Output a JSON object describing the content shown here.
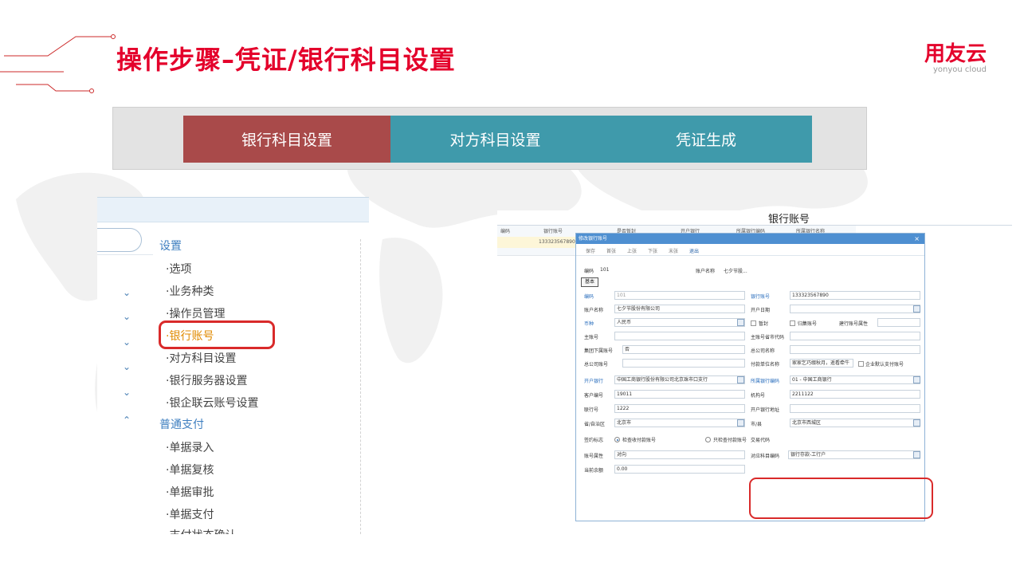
{
  "slide": {
    "title": "操作步骤–凭证/银行科目设置"
  },
  "brand": {
    "logo_cn": "用友云",
    "logo_en": "yonyou cloud"
  },
  "tabs": [
    {
      "label": "银行科目设置"
    },
    {
      "label": "对方科目设置"
    },
    {
      "label": "凭证生成"
    }
  ],
  "menu": {
    "section1": "设置",
    "items1": [
      "·选项",
      "·业务种类",
      "·操作员管理",
      "·银行账号",
      "·对方科目设置",
      "·银行服务器设置",
      "·银企联云账号设置"
    ],
    "section2": "普通支付",
    "items2": [
      "·单据录入",
      "·单据复核",
      "·单据审批",
      "·单据支付",
      "·支付状态确认"
    ]
  },
  "bank_list": {
    "title": "银行账号",
    "columns": [
      "编码",
      "银行账号",
      "是否暂封",
      "开户银行",
      "所属银行编码",
      "所属银行名称"
    ],
    "row1_account": "133323567890"
  },
  "dialog": {
    "title": "修改银行账号",
    "close": "×",
    "toolbar": [
      "保存",
      "首张",
      "上张",
      "下张",
      "末张",
      "退出"
    ],
    "summary_code_label": "编码",
    "summary_code": "101",
    "summary_name_label": "账户名称",
    "summary_name": "七夕节股...",
    "tab": "基本",
    "fields": {
      "code_label": "编码",
      "code": "101",
      "bank_account_label": "银行账号",
      "bank_account": "133323567890",
      "account_name_label": "账户名称",
      "account_name": "七夕节股份有限公司",
      "open_date_label": "开户日期",
      "open_date": "",
      "currency_label": "币种",
      "currency": "人民币",
      "frozen_label": "暂封",
      "collect_label": "归集账号",
      "ccb_attr_label": "建行账号属性",
      "main_account_label": "主账号",
      "main_city_label": "主账号省市代码",
      "group_sub_label": "集团下属账号",
      "group_sub": "否",
      "hq_name_label": "总公司名称",
      "hq_account_label": "总公司账号",
      "payer_unit_label": "付款单位名称",
      "payer_unit": "家家乞巧缀秋月，遥看牵牛",
      "corp_default_label": "企业默认支付账号",
      "open_bank_label": "开户银行",
      "open_bank": "中国工商银行股份有限公司北京珠市口支行",
      "bank_code_label": "所属银行编码",
      "bank_code": "01 - 中国工商银行",
      "customer_no_label": "客户编号",
      "customer_no": "19011",
      "org_no_label": "机构号",
      "org_no": "2211122",
      "union_no_label": "联行号",
      "union_no": "1222",
      "bank_addr_label": "开户银行地址",
      "province_label": "省/自治区",
      "province": "北京市",
      "city_label": "市/县",
      "city": "北京市西城区",
      "sign_label": "签约标志",
      "sign_opt1": "检查收付款账号",
      "sign_opt2": "只检查付款账号",
      "trade_code_label": "交易代码",
      "acct_attr_label": "账号属性",
      "acct_attr": "对向",
      "subject_code_label": "对应科目编码",
      "subject_code": "银行存款-工行户",
      "balance_label": "当前余额",
      "balance": "0.00"
    }
  }
}
